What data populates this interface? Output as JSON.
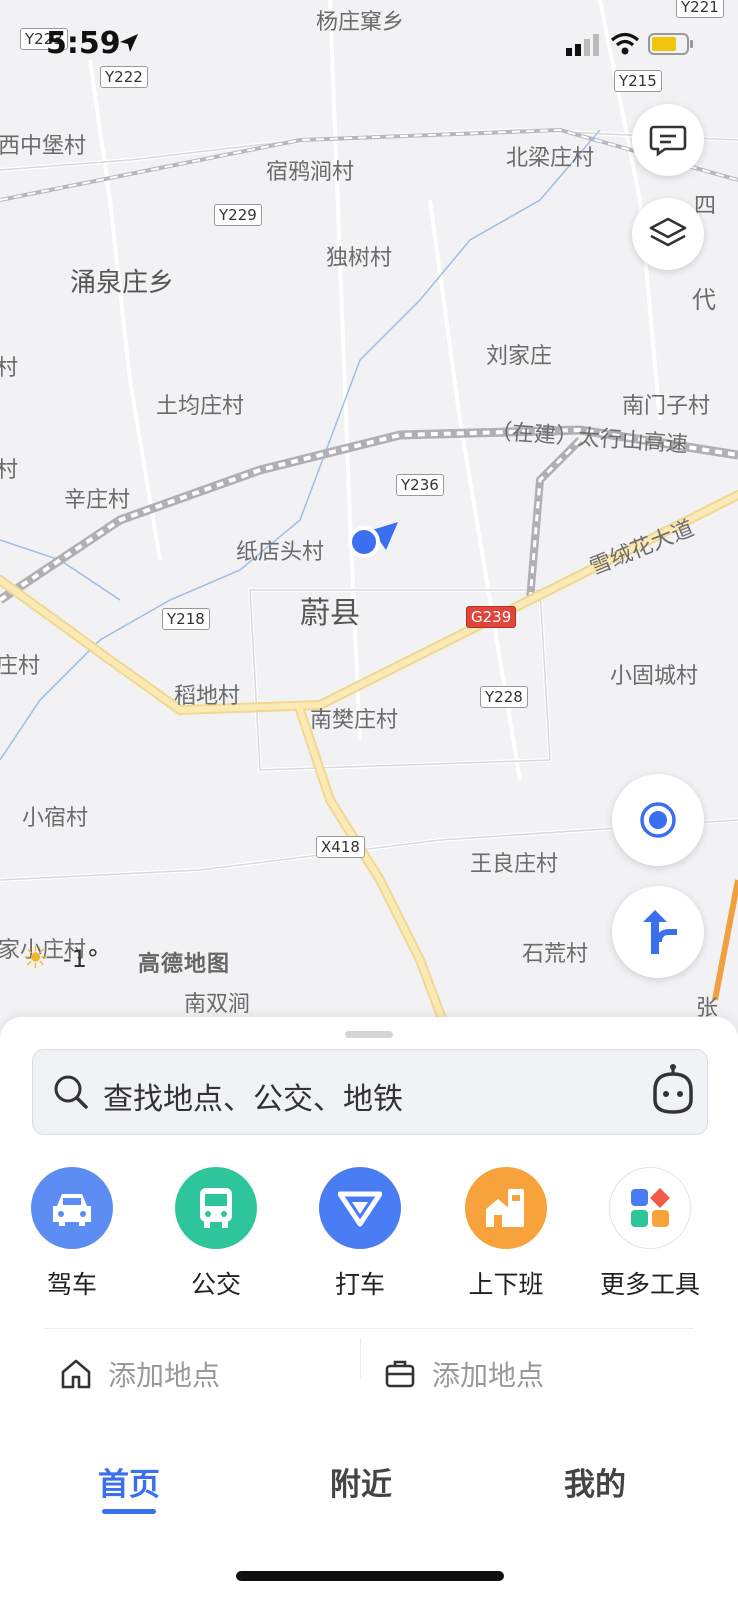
{
  "status": {
    "time": "5:59"
  },
  "map": {
    "places": [
      "杨庄窠乡",
      "西中堡村",
      "宿鸦涧村",
      "北梁庄村",
      "独树村",
      "涌泉庄乡",
      "刘家庄",
      "土均庄村",
      "南门子村",
      "辛庄村",
      "纸店头村",
      "蔚县",
      "小固城村",
      "稻地村",
      "南樊庄村",
      "小宿村",
      "王良庄村",
      "家小庄村",
      "石荒村",
      "代",
      "四",
      "村",
      "村",
      "庄村",
      "南双涧",
      "张"
    ],
    "road_names": {
      "highway": "（在建）太行山高速",
      "avenue": "雪绒花大道"
    },
    "road_labels": [
      "Y223",
      "Y221",
      "Y222",
      "Y215",
      "Y229",
      "Y236",
      "Y218",
      "G239",
      "Y228",
      "X418"
    ],
    "logo": "高德地图",
    "weather": "-1°"
  },
  "search": {
    "placeholder": "查找地点、公交、地铁"
  },
  "tools": [
    {
      "label": "驾车",
      "icon": "car-icon",
      "color": "#5b8df2"
    },
    {
      "label": "公交",
      "icon": "bus-icon",
      "color": "#2fc59a"
    },
    {
      "label": "打车",
      "icon": "taxi-icon",
      "color": "#4a7cf4"
    },
    {
      "label": "上下班",
      "icon": "commute-icon",
      "color": "#f7a23b"
    },
    {
      "label": "更多工具",
      "icon": "more-tools-icon",
      "color": "#ffffff"
    }
  ],
  "quick_places": {
    "home": "添加地点",
    "work": "添加地点"
  },
  "tabs": [
    {
      "label": "首页"
    },
    {
      "label": "附近"
    },
    {
      "label": "我的"
    }
  ],
  "accent": "#3a6ff0"
}
